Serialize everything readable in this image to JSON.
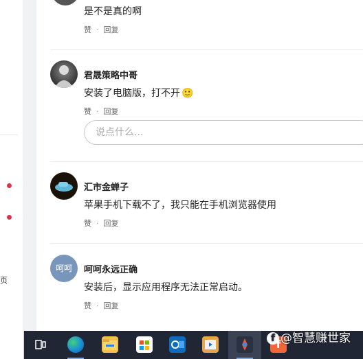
{
  "left": {
    "fragment": "页"
  },
  "comments": [
    {
      "text": "是不是真的啊",
      "like": "赞",
      "reply": "回复"
    },
    {
      "user": "君晟策略中哥",
      "text": "安装了电脑版，打不开",
      "emoji": "🙂",
      "like": "赞",
      "reply": "回复"
    },
    {
      "user": "汇市金蝉子",
      "text": "苹果手机下载不了，我只能在手机浏览器使用",
      "like": "赞",
      "reply": "回复"
    },
    {
      "user": "呵呵永远正确",
      "avatar_text": "呵呵",
      "text": "安装后，显示应用程序无法正常启动。",
      "like": "赞",
      "reply": "回复"
    }
  ],
  "reply_box": {
    "placeholder": "说点什么..."
  },
  "separator_dot": "·",
  "watermark": {
    "prefix": "f",
    "text": "@智慧赚世家"
  },
  "taskbar": {
    "icons": [
      "task-view-icon",
      "edge-icon",
      "file-explorer-icon",
      "store-icon",
      "outlook-icon",
      "video-app-icon",
      "app-icon-active",
      "app-icon-f"
    ]
  },
  "colors": {
    "accent_red": "#d9354a",
    "taskbar": "#202634"
  }
}
